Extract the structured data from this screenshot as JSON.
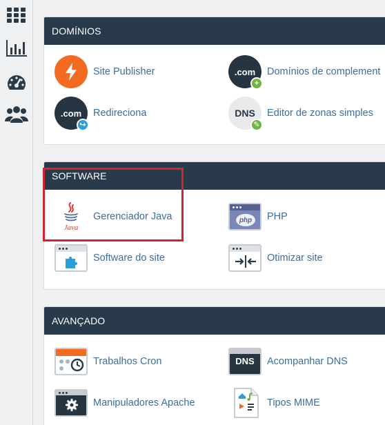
{
  "sidebar": {
    "items": [
      {
        "icon": "apps-grid-icon"
      },
      {
        "icon": "bar-chart-icon"
      },
      {
        "icon": "dashboard-gauge-icon"
      },
      {
        "icon": "users-group-icon"
      }
    ]
  },
  "sections": {
    "dominios": {
      "title": "DOMÍNIOS",
      "items": [
        {
          "label": "Site Publisher",
          "icon": "lightning-bolt-icon"
        },
        {
          "label": "Domínios de complement",
          "icon": "dotcom-add-icon"
        },
        {
          "label": "Redireciona",
          "icon": "dotcom-redirect-icon"
        },
        {
          "label": "Editor de zonas simples",
          "icon": "dns-edit-icon"
        }
      ]
    },
    "software": {
      "title": "SOFTWARE",
      "items": [
        {
          "label": "Gerenciador Java",
          "icon": "java-logo-icon",
          "icon_text": "Java"
        },
        {
          "label": "PHP",
          "icon": "php-window-icon",
          "icon_text": "php"
        },
        {
          "label": "Software do site",
          "icon": "puzzle-window-icon"
        },
        {
          "label": "Otimizar site",
          "icon": "compress-window-icon"
        }
      ]
    },
    "avancado": {
      "title": "AVANÇADO",
      "items": [
        {
          "label": "Trabalhos Cron",
          "icon": "calendar-clock-icon"
        },
        {
          "label": "Acompanhar DNS",
          "icon": "dns-window-icon",
          "icon_text": "DNS"
        },
        {
          "label": "Manipuladores Apache",
          "icon": "gear-window-icon"
        },
        {
          "label": "Tipos MIME",
          "icon": "mime-file-icon"
        }
      ]
    }
  },
  "icon_text": {
    "dotcom": ".com",
    "dns": "DNS"
  },
  "colors": {
    "header_bg": "#293a4a",
    "link": "#3b6ea0",
    "accent_orange": "#f26b21",
    "badge_green": "#6fb544",
    "badge_blue": "#2a9fd8",
    "highlight_red": "#d7222e"
  }
}
